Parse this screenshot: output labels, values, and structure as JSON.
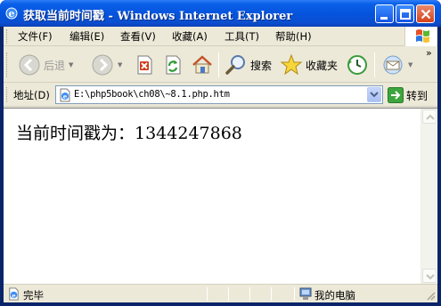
{
  "window": {
    "title": "获取当前时间戳 - Windows Internet Explorer"
  },
  "menu": {
    "items": [
      "文件(F)",
      "编辑(E)",
      "查看(V)",
      "收藏(A)",
      "工具(T)",
      "帮助(H)"
    ]
  },
  "toolbar": {
    "back_label": "后退",
    "search_label": "搜索",
    "favorites_label": "收藏夹",
    "more": "»"
  },
  "address": {
    "label": "地址(D)",
    "url": "E:\\php5book\\ch08\\~8.1.php.htm",
    "go_label": "转到"
  },
  "content": {
    "text": "当前时间戳为：1344247868"
  },
  "status": {
    "text": "完毕",
    "zone": "我的电脑"
  }
}
